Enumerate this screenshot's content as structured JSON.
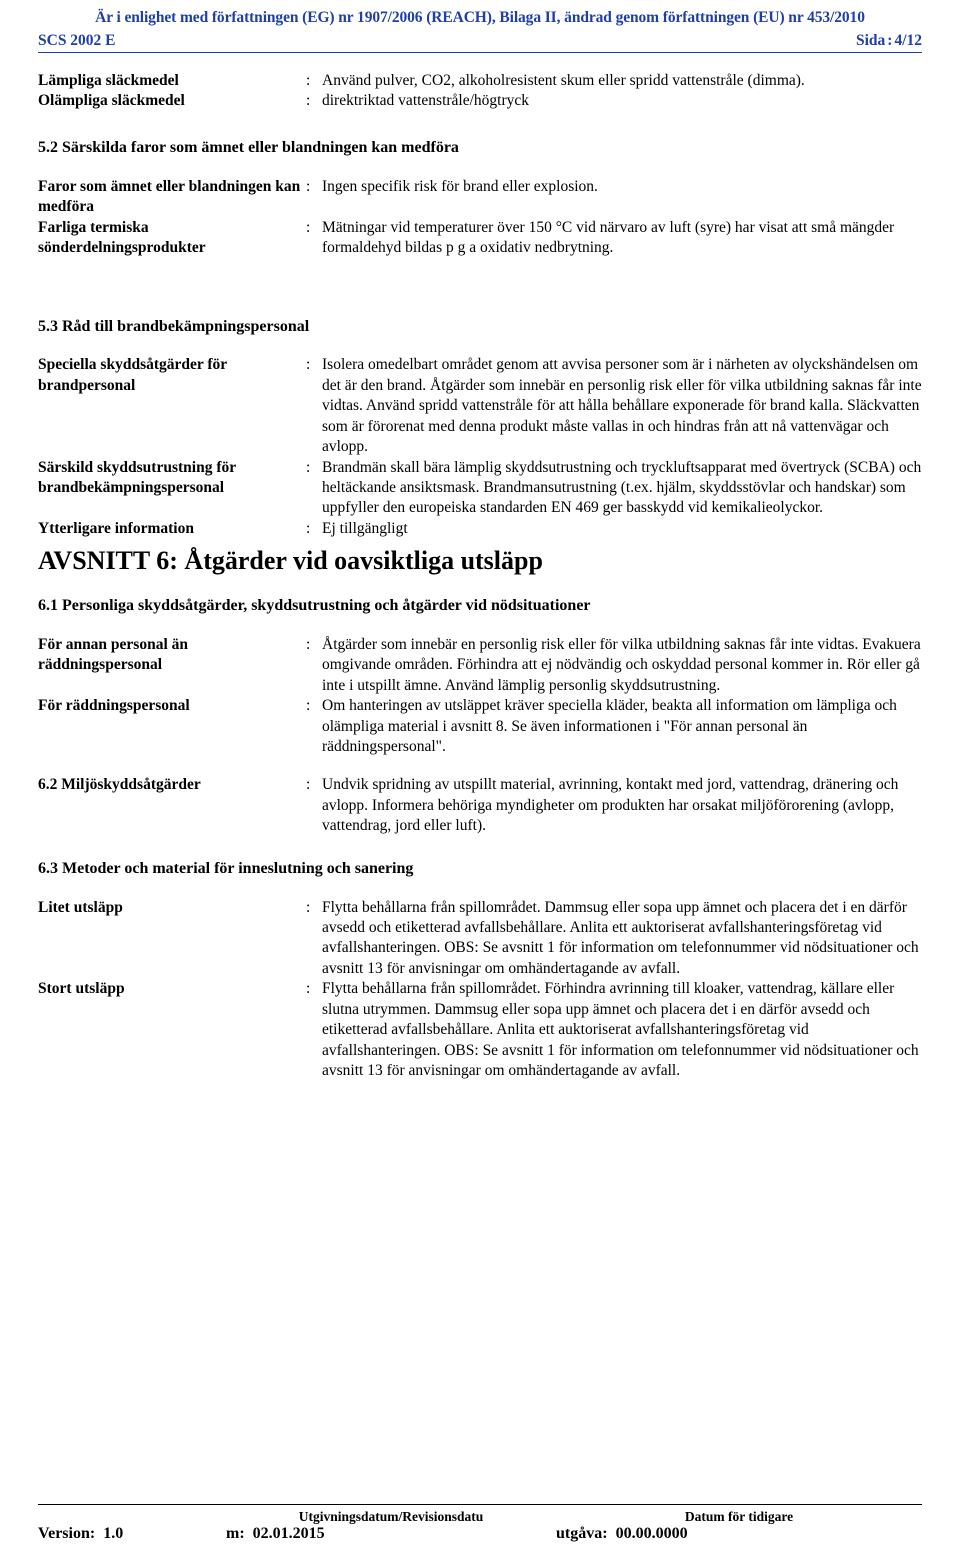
{
  "header": {
    "regulation_line": "Är i enlighet med författningen (EG) nr 1907/2006 (REACH), Bilaga II, ändrad genom författningen (EU) nr 453/2010",
    "product_code": "SCS 2002 E",
    "page_label": "Sida",
    "page_colon": ":",
    "page_value": "4/12"
  },
  "extinguish": {
    "suitable_label": "Lämpliga släckmedel",
    "suitable_colon": ":",
    "suitable_value": "Använd pulver, CO2, alkoholresistent skum eller spridd vattenstråle (dimma).",
    "unsuitable_label": "Olämpliga släckmedel",
    "unsuitable_colon": ":",
    "unsuitable_value": "direktriktad vattenstråle/högtryck"
  },
  "section52": {
    "number": "5.2",
    "title": "Särskilda faror som ämnet eller blandningen kan medföra",
    "rows": [
      {
        "label": "Faror som ämnet eller blandningen kan medföra",
        "colon": ":",
        "value": "Ingen specifik risk för brand eller explosion."
      },
      {
        "label": "Farliga termiska sönderdelningsprodukter",
        "colon": ":",
        "value": "Mätningar vid temperaturer över 150 °C vid närvaro av luft (syre) har visat att små mängder formaldehyd bildas p g a oxidativ nedbrytning."
      }
    ]
  },
  "section53": {
    "number": "5.3",
    "title": "Råd till brandbekämpningspersonal",
    "rows": [
      {
        "label": "Speciella skyddsåtgärder för brandpersonal",
        "colon": ":",
        "value": "Isolera omedelbart området genom att avvisa personer som är i närheten av olyckshändelsen om det är den brand. Åtgärder som innebär en personlig risk eller för vilka utbildning saknas får inte vidtas. Använd spridd vattenstråle för att hålla behållare exponerade för brand kalla. Släckvatten som är förorenat med denna produkt måste vallas in och hindras från att nå vattenvägar och avlopp."
      },
      {
        "label": "Särskild skyddsutrustning för brandbekämpningspersonal",
        "colon": ":",
        "value": "Brandmän skall bära lämplig skyddsutrustning och tryckluftsapparat med övertryck (SCBA) och heltäckande ansiktsmask. Brandmansutrustning (t.ex. hjälm, skyddsstövlar och handskar) som uppfyller den europeiska standarden EN 469 ger basskydd vid kemikalieolyckor."
      },
      {
        "label": "Ytterligare information",
        "colon": ":",
        "value": "Ej tillgängligt"
      }
    ]
  },
  "section6": {
    "heading": "AVSNITT 6: Åtgärder vid oavsiktliga utsläpp",
    "sub61": {
      "number": "6.1",
      "title": "Personliga skyddsåtgärder, skyddsutrustning och åtgärder vid nödsituationer",
      "rows": [
        {
          "label": "För annan personal än räddningspersonal",
          "colon": ":",
          "value": "Åtgärder som innebär en personlig risk eller för vilka utbildning saknas får inte vidtas. Evakuera omgivande områden. Förhindra att ej nödvändig och oskyddad personal kommer in. Rör eller gå inte i utspillt ämne. Använd lämplig personlig skyddsutrustning."
        },
        {
          "label": "För räddningspersonal",
          "colon": ":",
          "value": "Om hanteringen av utsläppet kräver speciella kläder, beakta all information om lämpliga och olämpliga material i avsnitt 8. Se även informationen i \"För annan personal än räddningspersonal\"."
        }
      ]
    },
    "sub62": {
      "number": "6.2",
      "title": "Miljöskyddsåtgärder",
      "colon": ":",
      "value": "Undvik spridning av utspillt material, avrinning, kontakt med jord, vattendrag, dränering och avlopp. Informera behöriga myndigheter om produkten har orsakat miljöförorening (avlopp, vattendrag, jord eller luft)."
    },
    "sub63": {
      "number": "6.3",
      "title": "Metoder och material för inneslutning och sanering",
      "rows": [
        {
          "label": "Litet utsläpp",
          "colon": ":",
          "value": "Flytta behållarna från spillområdet. Dammsug eller sopa upp ämnet och placera det i en därför avsedd och etiketterad avfallsbehållare. Anlita ett auktoriserat avfallshanteringsföretag vid avfallshanteringen. OBS: Se avsnitt 1 för information om telefonnummer vid nödsituationer och avsnitt 13 för anvisningar om omhändertagande av avfall."
        },
        {
          "label": "Stort utsläpp",
          "colon": ":",
          "value": "Flytta behållarna från spillområdet. Förhindra avrinning till kloaker, vattendrag, källare eller slutna utrymmen. Dammsug eller sopa upp ämnet och placera det i en därför avsedd och etiketterad avfallsbehållare. Anlita ett auktoriserat avfallshanteringsföretag vid avfallshanteringen. OBS: Se avsnitt 1 för information om telefonnummer vid nödsituationer och avsnitt 13 för anvisningar om omhändertagande av avfall."
        }
      ]
    }
  },
  "footer": {
    "version_label": "Version:",
    "version_value": "1.0",
    "issue_head": "Utgivningsdatum/Revisionsdatu",
    "issue_label": "m:",
    "issue_value": "02.01.2015",
    "prev_head": "Datum för tidigare",
    "prev_label": "utgåva:",
    "prev_value": "00.00.0000"
  }
}
